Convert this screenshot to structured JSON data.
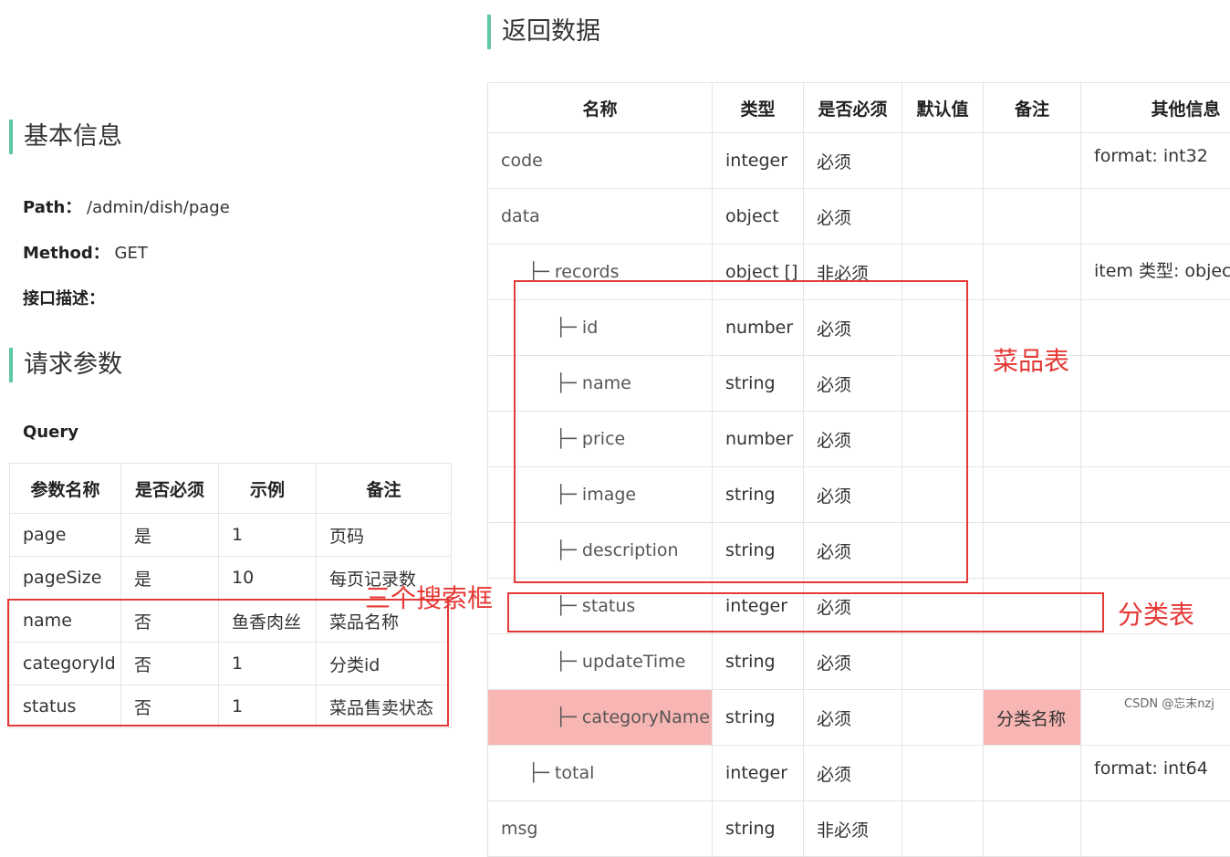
{
  "basic": {
    "title": "基本信息",
    "path_label": "Path：",
    "path_value": "/admin/dish/page",
    "method_label": "Method：",
    "method_value": "GET",
    "desc_label": "接口描述："
  },
  "request": {
    "title": "请求参数",
    "query_label": "Query",
    "headers": [
      "参数名称",
      "是否必须",
      "示例",
      "备注"
    ],
    "rows": [
      [
        "page",
        "是",
        "1",
        "页码"
      ],
      [
        "pageSize",
        "是",
        "10",
        "每页记录数"
      ],
      [
        "name",
        "否",
        "鱼香肉丝",
        "菜品名称"
      ],
      [
        "categoryId",
        "否",
        "1",
        "分类id"
      ],
      [
        "status",
        "否",
        "1",
        "菜品售卖状态"
      ]
    ]
  },
  "response": {
    "title": "返回数据",
    "headers": [
      "名称",
      "类型",
      "是否必须",
      "默认值",
      "备注",
      "其他信息"
    ],
    "rows": [
      {
        "name": "code",
        "type": "integer",
        "required": "必须",
        "default": "",
        "note": "",
        "other": "format: int32"
      },
      {
        "name": "data",
        "type": "object",
        "required": "必须",
        "default": "",
        "note": "",
        "other": ""
      },
      {
        "name": "├─ records",
        "type": "object []",
        "required": "非必须",
        "default": "",
        "note": "",
        "other": "item 类型: objec"
      },
      {
        "name": "├─ id",
        "type": "number",
        "required": "必须",
        "default": "",
        "note": "",
        "other": ""
      },
      {
        "name": "├─ name",
        "type": "string",
        "required": "必须",
        "default": "",
        "note": "",
        "other": ""
      },
      {
        "name": "├─ price",
        "type": "number",
        "required": "必须",
        "default": "",
        "note": "",
        "other": ""
      },
      {
        "name": "├─ image",
        "type": "string",
        "required": "必须",
        "default": "",
        "note": "",
        "other": ""
      },
      {
        "name": "├─ description",
        "type": "string",
        "required": "必须",
        "default": "",
        "note": "",
        "other": ""
      },
      {
        "name": "├─ status",
        "type": "integer",
        "required": "必须",
        "default": "",
        "note": "",
        "other": ""
      },
      {
        "name": "├─ updateTime",
        "type": "string",
        "required": "必须",
        "default": "",
        "note": "",
        "other": ""
      },
      {
        "name": "├─ categoryName",
        "type": "string",
        "required": "必须",
        "default": "",
        "note": "分类名称",
        "other": ""
      },
      {
        "name": "├─ total",
        "type": "integer",
        "required": "必须",
        "default": "",
        "note": "",
        "other": "format: int64"
      },
      {
        "name": "msg",
        "type": "string",
        "required": "非必须",
        "default": "",
        "note": "",
        "other": ""
      }
    ]
  },
  "annotations": {
    "search_boxes": "三个搜索框",
    "dish_table": "菜品表",
    "category_table": "分类表"
  },
  "watermark": "CSDN @忘末nzj",
  "colors": {
    "accent": "#5fc7a3",
    "annotation_red": "#e53935",
    "highlight": "#f7b6b3"
  }
}
